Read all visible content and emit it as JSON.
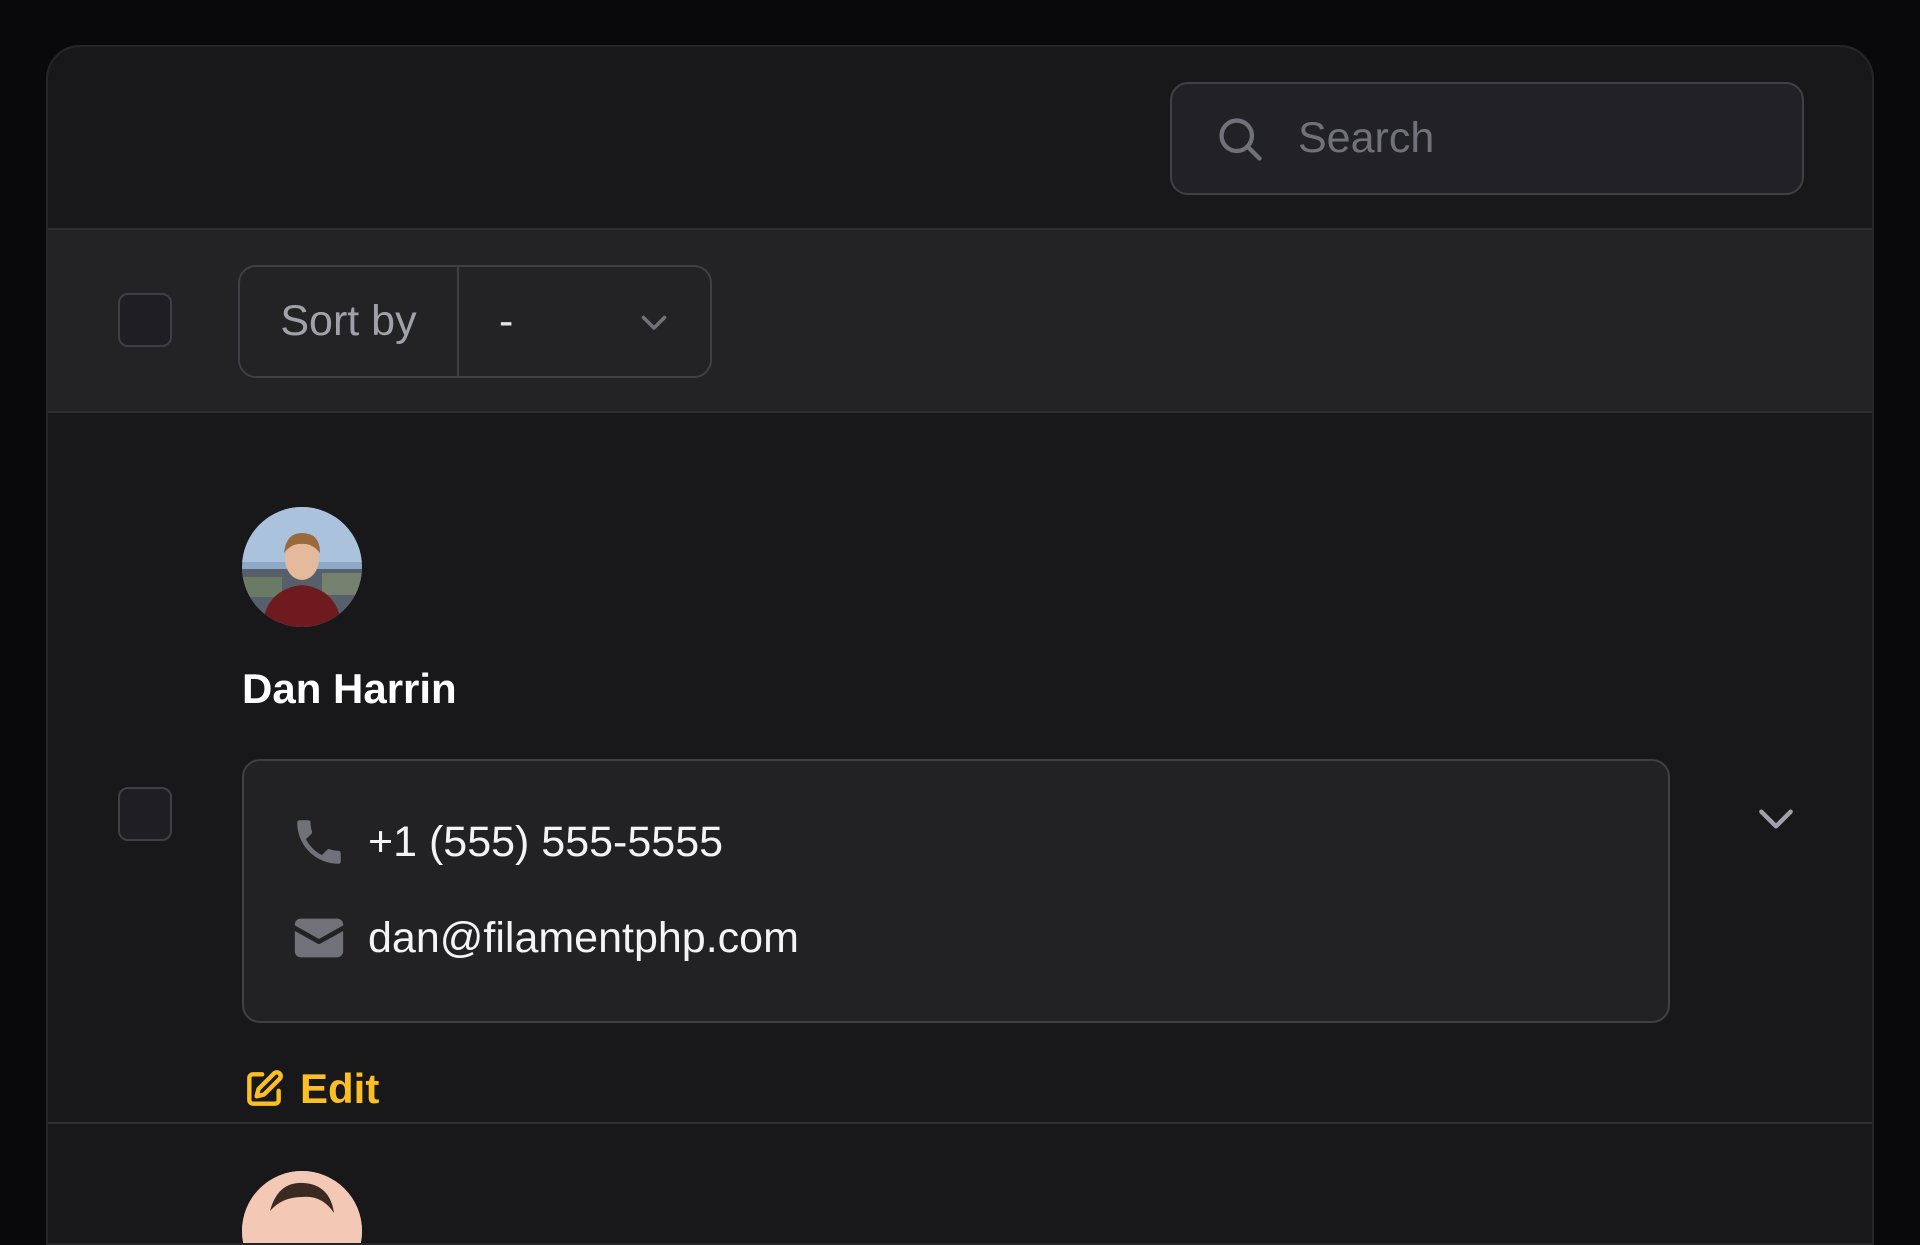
{
  "search": {
    "placeholder": "Search"
  },
  "toolbar": {
    "sort_label": "Sort by",
    "sort_value": "-"
  },
  "records": [
    {
      "name": "Dan Harrin",
      "phone": "+1 (555) 555-5555",
      "email": "dan@filamentphp.com",
      "edit_label": "Edit"
    }
  ],
  "colors": {
    "accent": "#fbbf24",
    "background": "#18181b",
    "border": "#3f3f46"
  },
  "icons": [
    "search-icon",
    "chevron-down-icon",
    "phone-icon",
    "envelope-icon",
    "pencil-square-icon"
  ]
}
